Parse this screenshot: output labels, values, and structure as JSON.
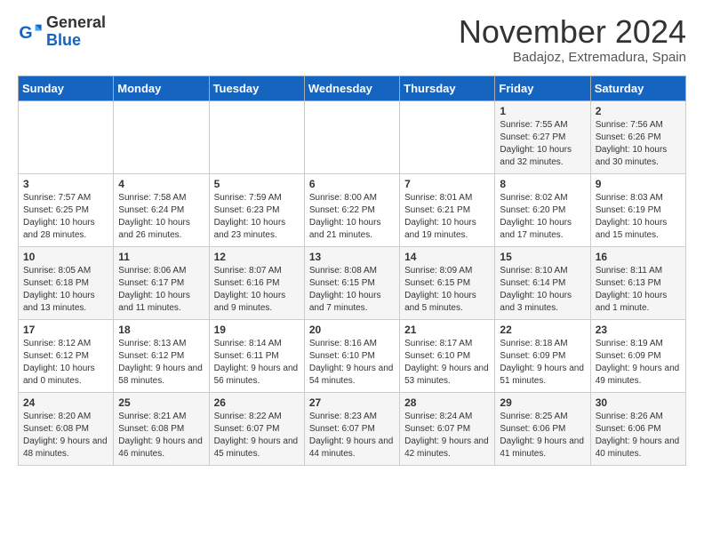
{
  "logo": {
    "general": "General",
    "blue": "Blue"
  },
  "header": {
    "month": "November 2024",
    "location": "Badajoz, Extremadura, Spain"
  },
  "days": [
    "Sunday",
    "Monday",
    "Tuesday",
    "Wednesday",
    "Thursday",
    "Friday",
    "Saturday"
  ],
  "weeks": [
    [
      {
        "day": "",
        "content": ""
      },
      {
        "day": "",
        "content": ""
      },
      {
        "day": "",
        "content": ""
      },
      {
        "day": "",
        "content": ""
      },
      {
        "day": "",
        "content": ""
      },
      {
        "day": "1",
        "content": "Sunrise: 7:55 AM\nSunset: 6:27 PM\nDaylight: 10 hours and 32 minutes."
      },
      {
        "day": "2",
        "content": "Sunrise: 7:56 AM\nSunset: 6:26 PM\nDaylight: 10 hours and 30 minutes."
      }
    ],
    [
      {
        "day": "3",
        "content": "Sunrise: 7:57 AM\nSunset: 6:25 PM\nDaylight: 10 hours and 28 minutes."
      },
      {
        "day": "4",
        "content": "Sunrise: 7:58 AM\nSunset: 6:24 PM\nDaylight: 10 hours and 26 minutes."
      },
      {
        "day": "5",
        "content": "Sunrise: 7:59 AM\nSunset: 6:23 PM\nDaylight: 10 hours and 23 minutes."
      },
      {
        "day": "6",
        "content": "Sunrise: 8:00 AM\nSunset: 6:22 PM\nDaylight: 10 hours and 21 minutes."
      },
      {
        "day": "7",
        "content": "Sunrise: 8:01 AM\nSunset: 6:21 PM\nDaylight: 10 hours and 19 minutes."
      },
      {
        "day": "8",
        "content": "Sunrise: 8:02 AM\nSunset: 6:20 PM\nDaylight: 10 hours and 17 minutes."
      },
      {
        "day": "9",
        "content": "Sunrise: 8:03 AM\nSunset: 6:19 PM\nDaylight: 10 hours and 15 minutes."
      }
    ],
    [
      {
        "day": "10",
        "content": "Sunrise: 8:05 AM\nSunset: 6:18 PM\nDaylight: 10 hours and 13 minutes."
      },
      {
        "day": "11",
        "content": "Sunrise: 8:06 AM\nSunset: 6:17 PM\nDaylight: 10 hours and 11 minutes."
      },
      {
        "day": "12",
        "content": "Sunrise: 8:07 AM\nSunset: 6:16 PM\nDaylight: 10 hours and 9 minutes."
      },
      {
        "day": "13",
        "content": "Sunrise: 8:08 AM\nSunset: 6:15 PM\nDaylight: 10 hours and 7 minutes."
      },
      {
        "day": "14",
        "content": "Sunrise: 8:09 AM\nSunset: 6:15 PM\nDaylight: 10 hours and 5 minutes."
      },
      {
        "day": "15",
        "content": "Sunrise: 8:10 AM\nSunset: 6:14 PM\nDaylight: 10 hours and 3 minutes."
      },
      {
        "day": "16",
        "content": "Sunrise: 8:11 AM\nSunset: 6:13 PM\nDaylight: 10 hours and 1 minute."
      }
    ],
    [
      {
        "day": "17",
        "content": "Sunrise: 8:12 AM\nSunset: 6:12 PM\nDaylight: 10 hours and 0 minutes."
      },
      {
        "day": "18",
        "content": "Sunrise: 8:13 AM\nSunset: 6:12 PM\nDaylight: 9 hours and 58 minutes."
      },
      {
        "day": "19",
        "content": "Sunrise: 8:14 AM\nSunset: 6:11 PM\nDaylight: 9 hours and 56 minutes."
      },
      {
        "day": "20",
        "content": "Sunrise: 8:16 AM\nSunset: 6:10 PM\nDaylight: 9 hours and 54 minutes."
      },
      {
        "day": "21",
        "content": "Sunrise: 8:17 AM\nSunset: 6:10 PM\nDaylight: 9 hours and 53 minutes."
      },
      {
        "day": "22",
        "content": "Sunrise: 8:18 AM\nSunset: 6:09 PM\nDaylight: 9 hours and 51 minutes."
      },
      {
        "day": "23",
        "content": "Sunrise: 8:19 AM\nSunset: 6:09 PM\nDaylight: 9 hours and 49 minutes."
      }
    ],
    [
      {
        "day": "24",
        "content": "Sunrise: 8:20 AM\nSunset: 6:08 PM\nDaylight: 9 hours and 48 minutes."
      },
      {
        "day": "25",
        "content": "Sunrise: 8:21 AM\nSunset: 6:08 PM\nDaylight: 9 hours and 46 minutes."
      },
      {
        "day": "26",
        "content": "Sunrise: 8:22 AM\nSunset: 6:07 PM\nDaylight: 9 hours and 45 minutes."
      },
      {
        "day": "27",
        "content": "Sunrise: 8:23 AM\nSunset: 6:07 PM\nDaylight: 9 hours and 44 minutes."
      },
      {
        "day": "28",
        "content": "Sunrise: 8:24 AM\nSunset: 6:07 PM\nDaylight: 9 hours and 42 minutes."
      },
      {
        "day": "29",
        "content": "Sunrise: 8:25 AM\nSunset: 6:06 PM\nDaylight: 9 hours and 41 minutes."
      },
      {
        "day": "30",
        "content": "Sunrise: 8:26 AM\nSunset: 6:06 PM\nDaylight: 9 hours and 40 minutes."
      }
    ]
  ]
}
